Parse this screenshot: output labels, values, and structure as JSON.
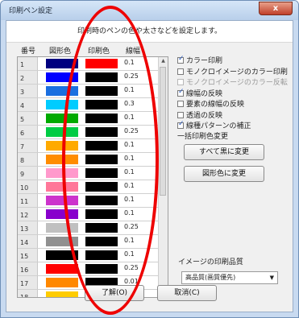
{
  "window": {
    "title": "印刷ペン設定",
    "close_label": "x"
  },
  "description": "印刷時のペンの色や太さなどを設定します。",
  "table": {
    "headers": {
      "number": "番号",
      "shape_color": "図形色",
      "print_color": "印刷色",
      "line_width": "線幅"
    },
    "rows": [
      {
        "num": "1",
        "shape_color": "#000080",
        "print_color": "#ff0000",
        "width": "0.1"
      },
      {
        "num": "2",
        "shape_color": "#0000ff",
        "print_color": "#000000",
        "width": "0.25"
      },
      {
        "num": "3",
        "shape_color": "#1a6fe0",
        "print_color": "#000000",
        "width": "0.1"
      },
      {
        "num": "4",
        "shape_color": "#00ccff",
        "print_color": "#000000",
        "width": "0.3"
      },
      {
        "num": "5",
        "shape_color": "#00aa00",
        "print_color": "#000000",
        "width": "0.1"
      },
      {
        "num": "6",
        "shape_color": "#00cc44",
        "print_color": "#000000",
        "width": "0.25"
      },
      {
        "num": "7",
        "shape_color": "#ffaa00",
        "print_color": "#000000",
        "width": "0.1"
      },
      {
        "num": "8",
        "shape_color": "#ff8c00",
        "print_color": "#000000",
        "width": "0.1"
      },
      {
        "num": "9",
        "shape_color": "#ff99cc",
        "print_color": "#000000",
        "width": "0.1"
      },
      {
        "num": "10",
        "shape_color": "#ff7799",
        "print_color": "#000000",
        "width": "0.1"
      },
      {
        "num": "11",
        "shape_color": "#cc33cc",
        "print_color": "#000000",
        "width": "0.1"
      },
      {
        "num": "12",
        "shape_color": "#8800cc",
        "print_color": "#000000",
        "width": "0.1"
      },
      {
        "num": "13",
        "shape_color": "#c0c0c0",
        "print_color": "#000000",
        "width": "0.25"
      },
      {
        "num": "14",
        "shape_color": "#909090",
        "print_color": "#000000",
        "width": "0.1"
      },
      {
        "num": "15",
        "shape_color": "#000000",
        "print_color": "#000000",
        "width": "0.1"
      },
      {
        "num": "16",
        "shape_color": "#ff0000",
        "print_color": "#000000",
        "width": "0.25"
      },
      {
        "num": "17",
        "shape_color": "#ff8800",
        "print_color": "#000000",
        "width": "0.01"
      },
      {
        "num": "18",
        "shape_color": "#ffcc00",
        "print_color": "#000000",
        "width": "0.01"
      }
    ]
  },
  "options": [
    {
      "label": "カラー印刷",
      "checked": true,
      "disabled": false
    },
    {
      "label": "モノクロイメージのカラー印刷",
      "checked": false,
      "disabled": false
    },
    {
      "label": "モノクロイメージのカラー反転",
      "checked": false,
      "disabled": true
    },
    {
      "label": "線幅の反映",
      "checked": true,
      "disabled": false
    },
    {
      "label": "要素の線幅の反映",
      "checked": false,
      "disabled": false
    },
    {
      "label": "透過の反映",
      "checked": false,
      "disabled": false
    },
    {
      "label": "線種パターンの補正",
      "checked": true,
      "disabled": false
    }
  ],
  "bulk_change": {
    "heading": "一括印刷色変更",
    "all_black_label": "すべて黒に変更",
    "shape_color_label": "図形色に変更"
  },
  "quality": {
    "heading": "イメージの印刷品質",
    "selected": "高品質(画質優先)"
  },
  "footer": {
    "ok_label": "了解(O)",
    "cancel_label": "取消(C)"
  },
  "colors": {
    "annotation_oval": "#ee0000"
  }
}
